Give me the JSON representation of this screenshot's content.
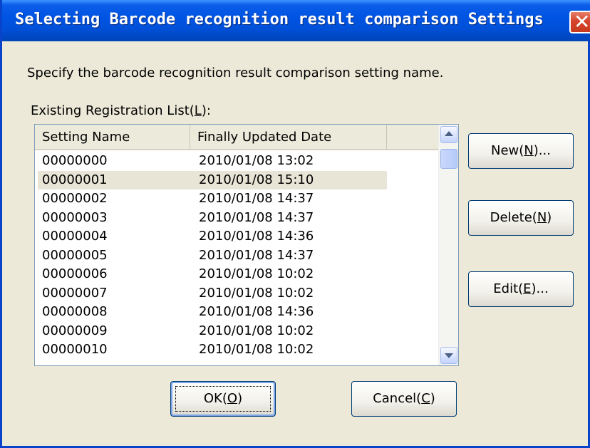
{
  "window": {
    "title": "Selecting Barcode recognition result comparison Settings",
    "close_glyph": "✕"
  },
  "instruction": "Specify the barcode recognition result comparison setting name.",
  "list_label": {
    "pre": "Existing Registration List(",
    "key": "L",
    "post": "):"
  },
  "list": {
    "columns": [
      "Setting Name",
      "Finally Updated Date"
    ],
    "selected_index": 1,
    "rows": [
      {
        "name": "00000000",
        "date": "2010/01/08 13:02"
      },
      {
        "name": "00000001",
        "date": "2010/01/08 15:10"
      },
      {
        "name": "00000002",
        "date": "2010/01/08 14:37"
      },
      {
        "name": "00000003",
        "date": "2010/01/08 14:37"
      },
      {
        "name": "00000004",
        "date": "2010/01/08 14:36"
      },
      {
        "name": "00000005",
        "date": "2010/01/08 14:37"
      },
      {
        "name": "00000006",
        "date": "2010/01/08 10:02"
      },
      {
        "name": "00000007",
        "date": "2010/01/08 10:02"
      },
      {
        "name": "00000008",
        "date": "2010/01/08 14:36"
      },
      {
        "name": "00000009",
        "date": "2010/01/08 10:02"
      },
      {
        "name": "00000010",
        "date": "2010/01/08 10:02"
      }
    ]
  },
  "buttons": {
    "new": {
      "pre": "New(",
      "key": "N",
      "post": ")..."
    },
    "delete": {
      "pre": "Delete(",
      "key": "N",
      "post": ")"
    },
    "edit": {
      "pre": "Edit(",
      "key": "E",
      "post": ")..."
    },
    "ok": {
      "pre": "OK(",
      "key": "O",
      "post": ")"
    },
    "cancel": {
      "pre": "Cancel(",
      "key": "C",
      "post": ")"
    }
  },
  "colors": {
    "titlebar": "#0054e3",
    "dialog_bg": "#ece9d8",
    "selected_row": "#e8e4d6",
    "close_button": "#d5442b"
  }
}
